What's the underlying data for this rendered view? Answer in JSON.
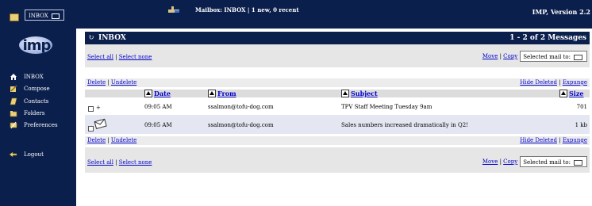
{
  "top": {
    "folder_select": "INBOX",
    "mailbox_status": "Mailbox: INBOX | 1 new, 0 recent",
    "version": "IMP, Version 2.2"
  },
  "logo": "imp",
  "sidebar": {
    "items": [
      {
        "label": "INBOX",
        "icon": "house-icon"
      },
      {
        "label": "Compose",
        "icon": "compose-icon"
      },
      {
        "label": "Contacts",
        "icon": "contacts-icon"
      },
      {
        "label": "Folders",
        "icon": "folders-icon"
      },
      {
        "label": "Preferences",
        "icon": "preferences-icon"
      },
      {
        "label": "Logout",
        "icon": "logout-icon"
      }
    ]
  },
  "mailbox": {
    "title": "INBOX",
    "count": "1 - 2 of 2 Messages",
    "select_all": "Select all",
    "select_none": "Select none",
    "move": "Move",
    "copy": "Copy",
    "move_target": "Selected mail to:",
    "delete": "Delete",
    "undelete": "Undelete",
    "hide_deleted": "Hide Deleted",
    "expunge": "Expunge",
    "columns": {
      "date": "Date",
      "from": "From",
      "subject": "Subject",
      "size": "Size"
    },
    "messages": [
      {
        "flag": "+",
        "date": "09:05 AM",
        "from": "ssalmon@tofu-dog.com",
        "subject": "TPV Staff Meeting Tuesday 9am",
        "size": "701"
      },
      {
        "flag": "",
        "date": "09:05 AM",
        "from": "ssalmon@tofu-dog.com",
        "subject": "Sales numbers increased dramatically in Q2!",
        "size": "1 kb"
      }
    ]
  },
  "colors": {
    "navy": "#0b1f4c",
    "link": "#0000cc",
    "band": "#e6e6e6"
  }
}
